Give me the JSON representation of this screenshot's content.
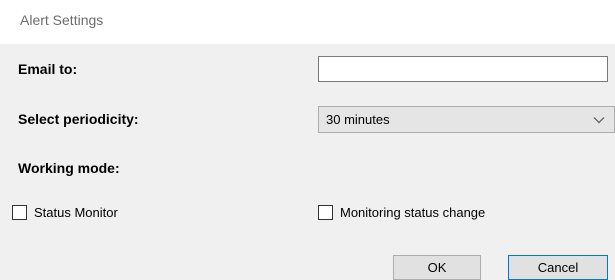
{
  "window": {
    "title": "Alert Settings"
  },
  "form": {
    "email_label": "Email to:",
    "email_value": "",
    "periodicity_label": "Select periodicity:",
    "periodicity_value": "30 minutes",
    "working_mode_label": "Working mode:"
  },
  "options": [
    {
      "label": "Status Monitor",
      "checked": false
    },
    {
      "label": "Monitoring status change",
      "checked": false
    }
  ],
  "buttons": {
    "ok_label": "OK",
    "cancel_label": "Cancel"
  },
  "icons": {
    "dropdown": "chevron-down-icon"
  },
  "colors": {
    "title_text": "#6d6d6d",
    "panel_bg": "#f0f0f0",
    "default_button_border": "#0078d7"
  }
}
